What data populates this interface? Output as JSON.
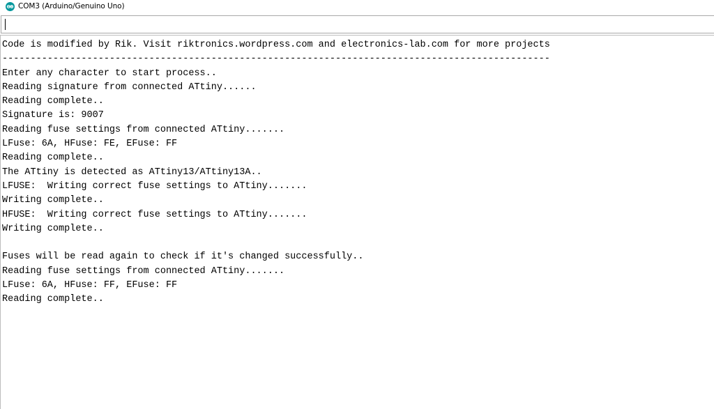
{
  "window": {
    "title": "COM3 (Arduino/Genuino Uno)",
    "icon": "arduino-logo-icon",
    "icon_color": "#00979C"
  },
  "send_field": {
    "value": ""
  },
  "serial_output": {
    "lines": [
      "Code is modified by Rik. Visit riktronics.wordpress.com and electronics-lab.com for more projects",
      "-------------------------------------------------------------------------------------------------",
      "Enter any character to start process..",
      "Reading signature from connected ATtiny......",
      "Reading complete..",
      "Signature is: 9007",
      "Reading fuse settings from connected ATtiny.......",
      "LFuse: 6A, HFuse: FE, EFuse: FF",
      "Reading complete..",
      "The ATtiny is detected as ATtiny13/ATtiny13A..",
      "LFUSE:  Writing correct fuse settings to ATtiny.......",
      "Writing complete..",
      "HFUSE:  Writing correct fuse settings to ATtiny.......",
      "Writing complete..",
      "",
      "Fuses will be read again to check if it's changed successfully..",
      "Reading fuse settings from connected ATtiny.......",
      "LFuse: 6A, HFuse: FF, EFuse: FF",
      "Reading complete.."
    ]
  }
}
